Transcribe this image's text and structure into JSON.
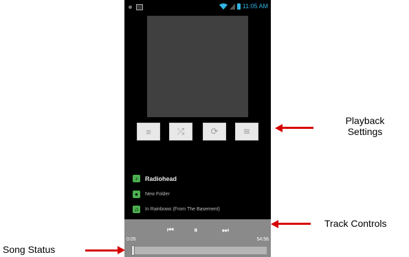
{
  "status_bar": {
    "time": "11:05 AM"
  },
  "playback_buttons": [
    {
      "name": "playlist-icon",
      "glyph": "≡"
    },
    {
      "name": "shuffle-icon",
      "glyph": "⤮"
    },
    {
      "name": "repeat-icon",
      "glyph": "⟳"
    },
    {
      "name": "equalizer-icon",
      "glyph": "≋"
    }
  ],
  "track_info": {
    "artist": "Radiohead",
    "folder": "New Folder",
    "album": "In Rainbows (From The Basement)"
  },
  "controls": {
    "prev_glyph": "⏮",
    "pause_glyph": "⏸",
    "next_glyph": "⏭",
    "elapsed": "0:05",
    "duration": "54:56",
    "progress_fraction": 0.0015
  },
  "annotations": {
    "playback_settings_line1": "Playback",
    "playback_settings_line2": "Settings",
    "track_controls": "Track Controls",
    "song_status": "Song Status"
  },
  "colors": {
    "accent": "#33b5e5",
    "arrow": "#d60000",
    "icon_green": "#4caf50"
  }
}
